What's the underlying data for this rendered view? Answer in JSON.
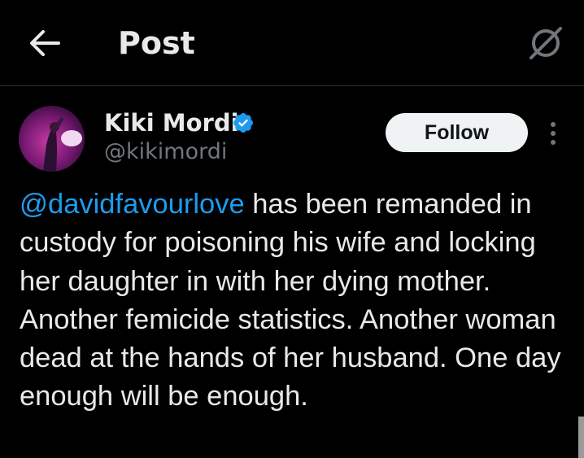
{
  "header": {
    "back_icon": "arrow-left-icon",
    "title": "Post",
    "grok_icon": "grok-icon"
  },
  "author": {
    "display_name": "Kiki Mordi",
    "handle": "@kikimordi",
    "verified_icon": "verified-badge-icon",
    "verified_color": "#1d9bf0"
  },
  "actions": {
    "follow_label": "Follow",
    "more_icon": "more-dots-icon"
  },
  "tweet": {
    "mention": "@davidfavourlove",
    "text": " has been remanded in custody for poisoning his wife and locking her daughter in with her dying mother. Another femicide statistics. Another woman dead at the hands of her husband. One day enough will be enough."
  },
  "colors": {
    "background": "#000000",
    "text_primary": "#e7e9ea",
    "text_secondary": "#71767b",
    "link": "#1d9bf0",
    "follow_bg": "#eff3f4",
    "divider": "#2f3336"
  }
}
